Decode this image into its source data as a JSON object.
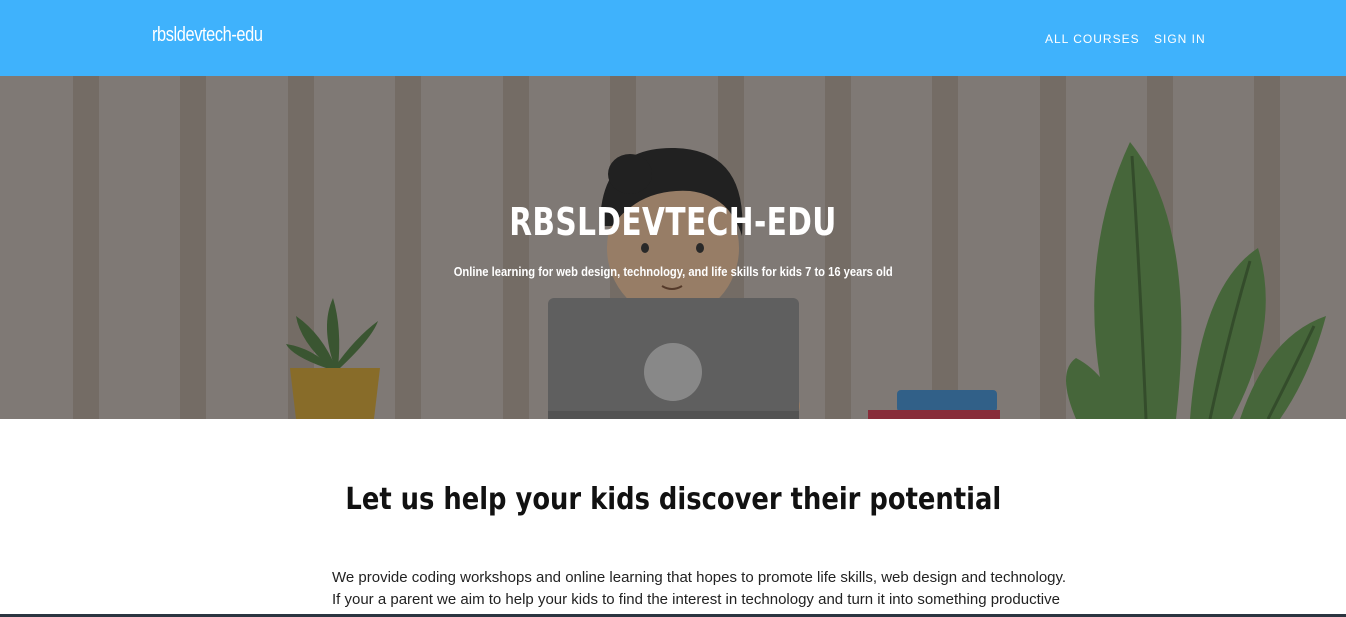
{
  "header": {
    "brand": "rbsldevtech-edu",
    "nav": [
      {
        "label": "ALL COURSES"
      },
      {
        "label": "SIGN IN"
      }
    ],
    "background_color": "#3fb2fc"
  },
  "hero": {
    "title": "RBSLDEVTECH-EDU",
    "subtitle": "Online learning for web design, technology, and life skills for kids 7 to 16 years old"
  },
  "intro": {
    "heading": "Let us help your kids discover their potential",
    "lines": [
      "We provide coding workshops and online learning that hopes to promote life skills, web design and technology.",
      "If your a parent we aim to help your kids to find the interest in technology and turn it into something productive"
    ]
  }
}
